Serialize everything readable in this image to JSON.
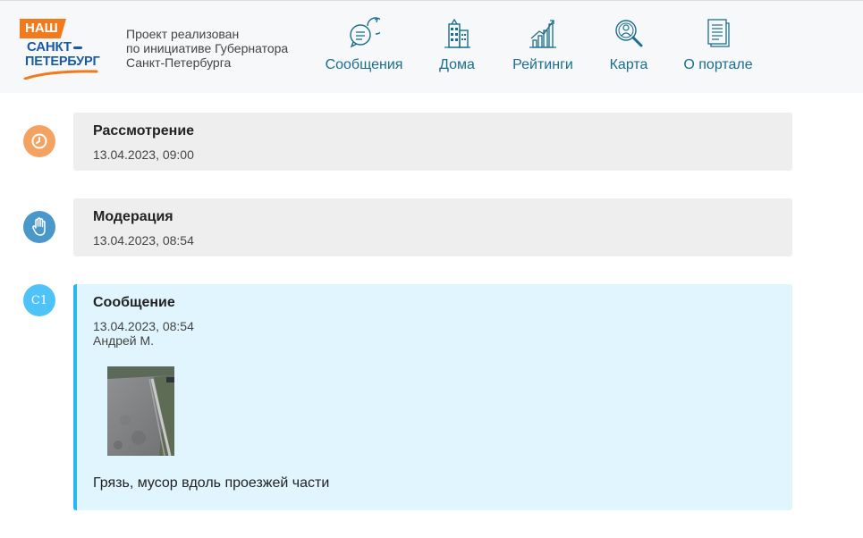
{
  "header": {
    "logo": {
      "line1": "НАШ",
      "line2": "САНКТ",
      "line3": "ПЕТЕРБУРГ"
    },
    "tagline": [
      "Проект реализован",
      "по инициативе Губернатора",
      "Санкт-Петербурга"
    ],
    "nav": [
      {
        "label": "Сообщения",
        "icon": "chat-bubbles-icon"
      },
      {
        "label": "Дома",
        "icon": "buildings-icon"
      },
      {
        "label": "Рейтинги",
        "icon": "rating-chart-icon"
      },
      {
        "label": "Карта",
        "icon": "map-search-icon"
      },
      {
        "label": "О портале",
        "icon": "document-icon"
      }
    ]
  },
  "timeline": [
    {
      "title": "Рассмотрение",
      "date": "13.04.2023, 09:00",
      "icon": "clock-icon",
      "color": "#f4a261"
    },
    {
      "title": "Модерация",
      "date": "13.04.2023, 08:54",
      "icon": "hand-icon",
      "color": "#4a97c9"
    },
    {
      "title": "Сообщение",
      "date": "13.04.2023, 08:54",
      "author": "Андрей М.",
      "badge": "C1",
      "color": "#4fc3f7",
      "text": "Грязь, мусор вдоль проезжей части"
    }
  ],
  "colors": {
    "accent": "#1a6d8f",
    "brand_orange": "#f07a1c",
    "brand_blue": "#1a5aa5",
    "message_border": "#29b6f6",
    "message_bg": "#e1f5fe"
  }
}
